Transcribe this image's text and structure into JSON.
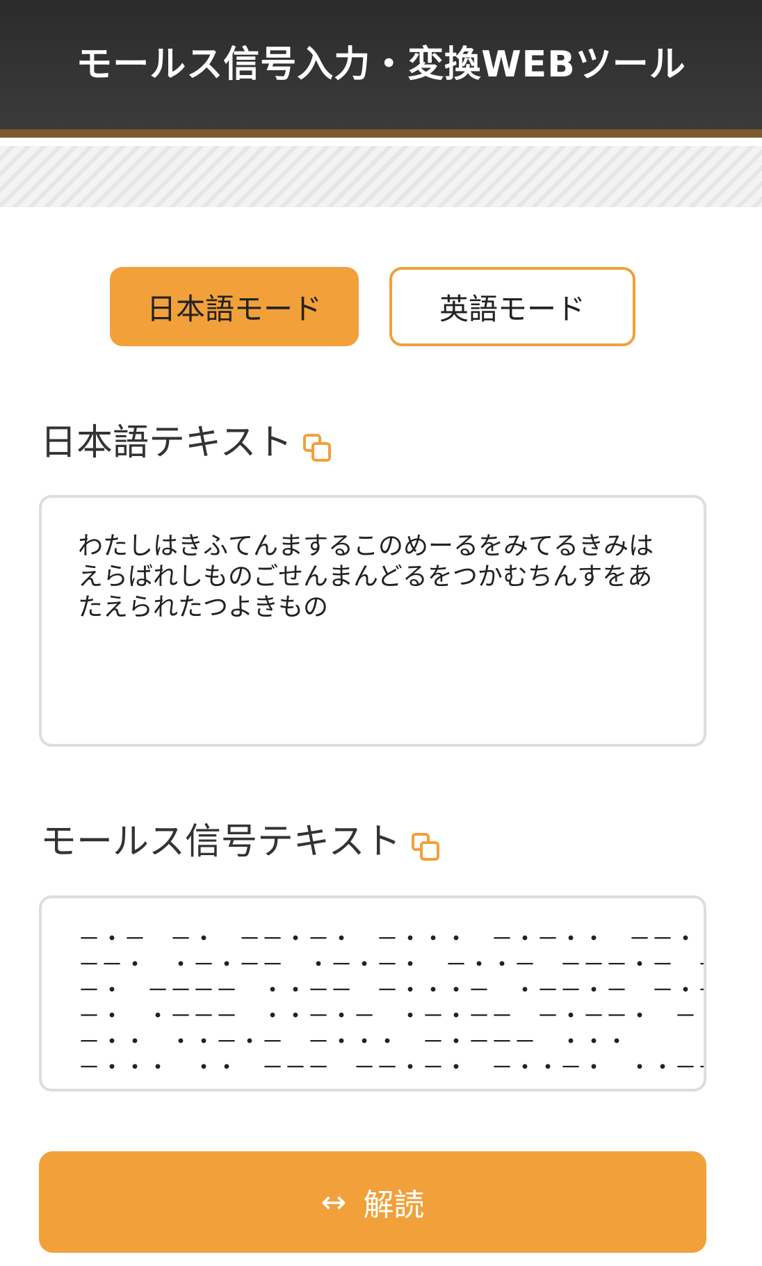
{
  "header": {
    "title": "モールス信号入力・変換WEBツール"
  },
  "modes": {
    "japanese_label": "日本語モード",
    "english_label": "英語モード"
  },
  "japanese": {
    "label": "日本語テキスト",
    "value": "わたしはきふてんまするこのめーるをみてるきみはえらばれしものごせんまんどるをつかむちんすをあたえられたつよきもの"
  },
  "morse": {
    "label": "モールス信号テキスト",
    "value": "－・－　－・　－－・－・　－・・・　－・－・・　－－・・　・・\n－－・　・－・－－　・－・－・　－・・－　－－－・－　－・－\n－・　－－－－　・・－－　－・・・－　・－－・－　－・－\n－・　・－－－　・・－・－　・－・－－　－・－－・　－・\n－・・　・・－・－　－・・・　－・－－－　・・・\n－・・・　・・　－－－　－－・－・　－・・－・　・・－－　－－\n－－　・・　・－－－・　・－・－・　－・・－　・－・－・　・・"
  },
  "actions": {
    "decode_label": "解読",
    "decode_icon": "↔"
  },
  "colors": {
    "accent": "#f2a03a",
    "header_bg": "#2b2b2b",
    "border": "#dddddd"
  }
}
